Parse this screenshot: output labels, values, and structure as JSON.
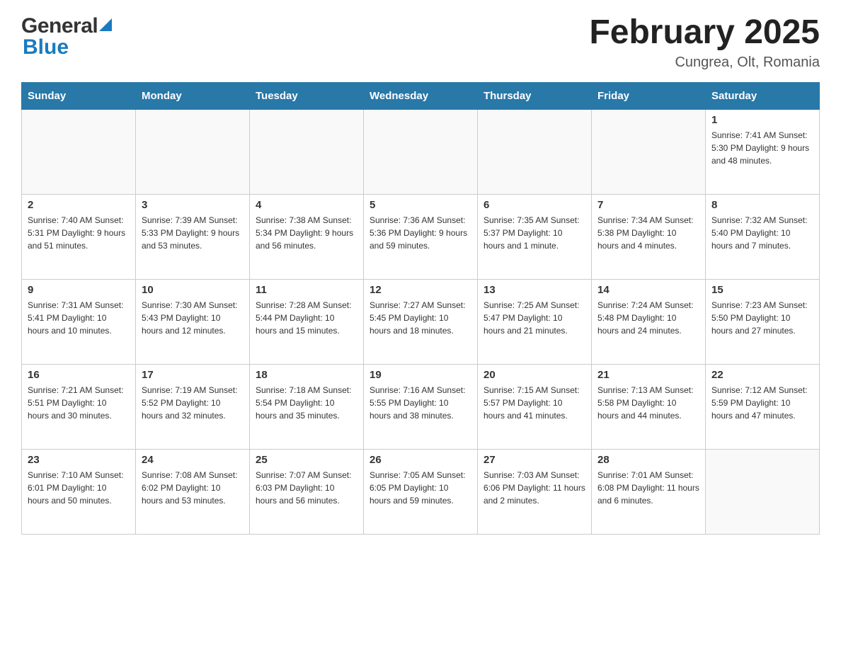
{
  "header": {
    "logo_general": "General",
    "logo_blue": "Blue",
    "month_title": "February 2025",
    "location": "Cungrea, Olt, Romania"
  },
  "weekdays": [
    "Sunday",
    "Monday",
    "Tuesday",
    "Wednesday",
    "Thursday",
    "Friday",
    "Saturday"
  ],
  "weeks": [
    [
      {
        "day": "",
        "info": ""
      },
      {
        "day": "",
        "info": ""
      },
      {
        "day": "",
        "info": ""
      },
      {
        "day": "",
        "info": ""
      },
      {
        "day": "",
        "info": ""
      },
      {
        "day": "",
        "info": ""
      },
      {
        "day": "1",
        "info": "Sunrise: 7:41 AM\nSunset: 5:30 PM\nDaylight: 9 hours\nand 48 minutes."
      }
    ],
    [
      {
        "day": "2",
        "info": "Sunrise: 7:40 AM\nSunset: 5:31 PM\nDaylight: 9 hours\nand 51 minutes."
      },
      {
        "day": "3",
        "info": "Sunrise: 7:39 AM\nSunset: 5:33 PM\nDaylight: 9 hours\nand 53 minutes."
      },
      {
        "day": "4",
        "info": "Sunrise: 7:38 AM\nSunset: 5:34 PM\nDaylight: 9 hours\nand 56 minutes."
      },
      {
        "day": "5",
        "info": "Sunrise: 7:36 AM\nSunset: 5:36 PM\nDaylight: 9 hours\nand 59 minutes."
      },
      {
        "day": "6",
        "info": "Sunrise: 7:35 AM\nSunset: 5:37 PM\nDaylight: 10 hours\nand 1 minute."
      },
      {
        "day": "7",
        "info": "Sunrise: 7:34 AM\nSunset: 5:38 PM\nDaylight: 10 hours\nand 4 minutes."
      },
      {
        "day": "8",
        "info": "Sunrise: 7:32 AM\nSunset: 5:40 PM\nDaylight: 10 hours\nand 7 minutes."
      }
    ],
    [
      {
        "day": "9",
        "info": "Sunrise: 7:31 AM\nSunset: 5:41 PM\nDaylight: 10 hours\nand 10 minutes."
      },
      {
        "day": "10",
        "info": "Sunrise: 7:30 AM\nSunset: 5:43 PM\nDaylight: 10 hours\nand 12 minutes."
      },
      {
        "day": "11",
        "info": "Sunrise: 7:28 AM\nSunset: 5:44 PM\nDaylight: 10 hours\nand 15 minutes."
      },
      {
        "day": "12",
        "info": "Sunrise: 7:27 AM\nSunset: 5:45 PM\nDaylight: 10 hours\nand 18 minutes."
      },
      {
        "day": "13",
        "info": "Sunrise: 7:25 AM\nSunset: 5:47 PM\nDaylight: 10 hours\nand 21 minutes."
      },
      {
        "day": "14",
        "info": "Sunrise: 7:24 AM\nSunset: 5:48 PM\nDaylight: 10 hours\nand 24 minutes."
      },
      {
        "day": "15",
        "info": "Sunrise: 7:23 AM\nSunset: 5:50 PM\nDaylight: 10 hours\nand 27 minutes."
      }
    ],
    [
      {
        "day": "16",
        "info": "Sunrise: 7:21 AM\nSunset: 5:51 PM\nDaylight: 10 hours\nand 30 minutes."
      },
      {
        "day": "17",
        "info": "Sunrise: 7:19 AM\nSunset: 5:52 PM\nDaylight: 10 hours\nand 32 minutes."
      },
      {
        "day": "18",
        "info": "Sunrise: 7:18 AM\nSunset: 5:54 PM\nDaylight: 10 hours\nand 35 minutes."
      },
      {
        "day": "19",
        "info": "Sunrise: 7:16 AM\nSunset: 5:55 PM\nDaylight: 10 hours\nand 38 minutes."
      },
      {
        "day": "20",
        "info": "Sunrise: 7:15 AM\nSunset: 5:57 PM\nDaylight: 10 hours\nand 41 minutes."
      },
      {
        "day": "21",
        "info": "Sunrise: 7:13 AM\nSunset: 5:58 PM\nDaylight: 10 hours\nand 44 minutes."
      },
      {
        "day": "22",
        "info": "Sunrise: 7:12 AM\nSunset: 5:59 PM\nDaylight: 10 hours\nand 47 minutes."
      }
    ],
    [
      {
        "day": "23",
        "info": "Sunrise: 7:10 AM\nSunset: 6:01 PM\nDaylight: 10 hours\nand 50 minutes."
      },
      {
        "day": "24",
        "info": "Sunrise: 7:08 AM\nSunset: 6:02 PM\nDaylight: 10 hours\nand 53 minutes."
      },
      {
        "day": "25",
        "info": "Sunrise: 7:07 AM\nSunset: 6:03 PM\nDaylight: 10 hours\nand 56 minutes."
      },
      {
        "day": "26",
        "info": "Sunrise: 7:05 AM\nSunset: 6:05 PM\nDaylight: 10 hours\nand 59 minutes."
      },
      {
        "day": "27",
        "info": "Sunrise: 7:03 AM\nSunset: 6:06 PM\nDaylight: 11 hours\nand 2 minutes."
      },
      {
        "day": "28",
        "info": "Sunrise: 7:01 AM\nSunset: 6:08 PM\nDaylight: 11 hours\nand 6 minutes."
      },
      {
        "day": "",
        "info": ""
      }
    ]
  ]
}
